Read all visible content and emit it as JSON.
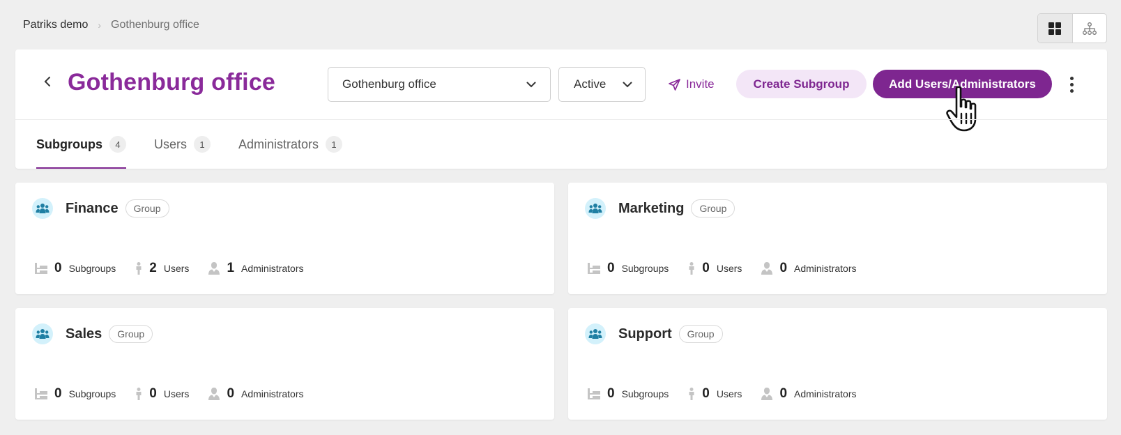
{
  "breadcrumb": {
    "root": "Patriks demo",
    "separator": "›",
    "current": "Gothenburg office"
  },
  "view_toggle": {
    "active": "grid-view",
    "options": [
      "grid-view-icon",
      "hierarchy-view-icon"
    ]
  },
  "header": {
    "title": "Gothenburg office",
    "group_select_value": "Gothenburg office",
    "status_select_value": "Active",
    "invite_label": "Invite",
    "create_subgroup_label": "Create Subgroup",
    "add_users_label": "Add Users/Administrators"
  },
  "tabs": [
    {
      "label": "Subgroups",
      "count": "4",
      "active": true
    },
    {
      "label": "Users",
      "count": "1",
      "active": false
    },
    {
      "label": "Administrators",
      "count": "1",
      "active": false
    }
  ],
  "groups": [
    {
      "name": "Finance",
      "badge": "Group",
      "subgroups": "0",
      "subgroups_label": "Subgroups",
      "users": "2",
      "users_label": "Users",
      "admins": "1",
      "admins_label": "Administrators"
    },
    {
      "name": "Marketing",
      "badge": "Group",
      "subgroups": "0",
      "subgroups_label": "Subgroups",
      "users": "0",
      "users_label": "Users",
      "admins": "0",
      "admins_label": "Administrators"
    },
    {
      "name": "Sales",
      "badge": "Group",
      "subgroups": "0",
      "subgroups_label": "Subgroups",
      "users": "0",
      "users_label": "Users",
      "admins": "0",
      "admins_label": "Administrators"
    },
    {
      "name": "Support",
      "badge": "Group",
      "subgroups": "0",
      "subgroups_label": "Subgroups",
      "users": "0",
      "users_label": "Users",
      "admins": "0",
      "admins_label": "Administrators"
    }
  ],
  "colors": {
    "brand_purple": "#7e2690",
    "title_purple": "#8a2a9a",
    "avatar_bg": "#d3f1fb",
    "avatar_icon": "#1f7fa3",
    "page_bg": "#efefef"
  }
}
